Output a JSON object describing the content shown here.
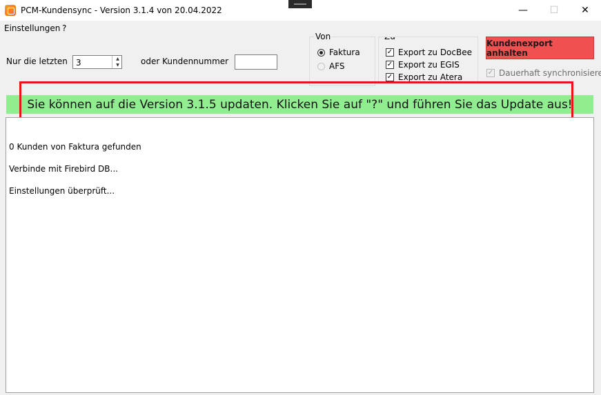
{
  "window": {
    "title": "PCM-Kundensync - Version 3.1.4 von 20.04.2022",
    "controls": {
      "minimize": "—",
      "maximize": "☐",
      "close": "✕"
    }
  },
  "menu": {
    "settings": "Einstellungen",
    "help": "?"
  },
  "filter": {
    "last_label": "Nur die letzten",
    "last_value": "3",
    "custno_label": "oder Kundennummer",
    "custno_value": ""
  },
  "source": {
    "title": "Von",
    "options": [
      {
        "label": "Faktura",
        "selected": true,
        "enabled": true
      },
      {
        "label": "AFS",
        "selected": false,
        "enabled": false
      }
    ]
  },
  "target": {
    "title": "Zu",
    "options": [
      {
        "label": "Export zu DocBee",
        "checked": true
      },
      {
        "label": "Export zu EGIS",
        "checked": true
      },
      {
        "label": "Export zu Atera",
        "checked": true
      }
    ]
  },
  "export_button": {
    "label": "Kundenexport anhalten",
    "color": "#f05050"
  },
  "permanent_sync": {
    "label": "Dauerhaft synchronisieren",
    "checked": true,
    "enabled": false
  },
  "banner": {
    "text": "Sie können auf die Version 3.1.5 updaten. Klicken Sie auf \"?\" und führen Sie das Update aus!",
    "color": "#90ee90",
    "highlight_color": "#e8141a"
  },
  "log": {
    "lines": [
      "0 Kunden von Faktura gefunden",
      "Verbinde mit Firebird DB...",
      "Einstellungen überprüft..."
    ]
  },
  "icons": {
    "app": "app-logo-icon",
    "check": "✓",
    "spin_up": "▲",
    "spin_down": "▼"
  }
}
